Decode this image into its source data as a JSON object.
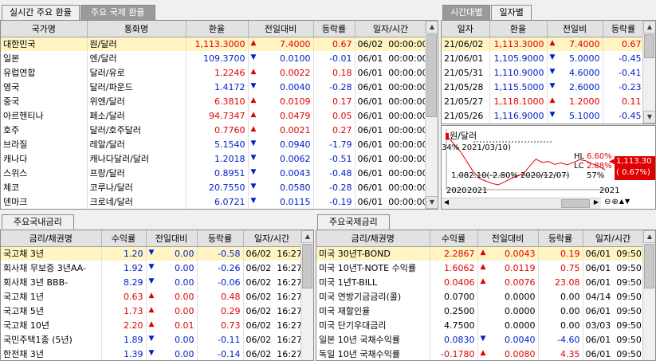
{
  "top_tabs": [
    "실시간 주요 환율",
    "주요 국제 환율"
  ],
  "fx": {
    "headers": [
      "국가명",
      "통화명",
      "환율",
      "전일대비",
      "등락률",
      "일자/시간"
    ],
    "rows": [
      {
        "country": "대한민국",
        "currency": "원/달러",
        "rate": "1,113.3000",
        "dir": "up",
        "change": "7.4000",
        "pct": "0.67",
        "date": "06/02",
        "time": "00:00:00",
        "color": "red"
      },
      {
        "country": "일본",
        "currency": "엔/달러",
        "rate": "109.3700",
        "dir": "dn",
        "change": "0.0100",
        "pct": "-0.01",
        "date": "06/01",
        "time": "00:00:00",
        "color": "blue"
      },
      {
        "country": "유럽연합",
        "currency": "달러/유로",
        "rate": "1.2246",
        "dir": "up",
        "change": "0.0022",
        "pct": "0.18",
        "date": "06/01",
        "time": "00:00:00",
        "color": "red"
      },
      {
        "country": "영국",
        "currency": "달러/파운드",
        "rate": "1.4172",
        "dir": "dn",
        "change": "0.0040",
        "pct": "-0.28",
        "date": "06/01",
        "time": "00:00:00",
        "color": "blue"
      },
      {
        "country": "중국",
        "currency": "위엔/달러",
        "rate": "6.3810",
        "dir": "up",
        "change": "0.0109",
        "pct": "0.17",
        "date": "06/01",
        "time": "00:00:00",
        "color": "red"
      },
      {
        "country": "아르헨티나",
        "currency": "페소/달러",
        "rate": "94.7347",
        "dir": "up",
        "change": "0.0479",
        "pct": "0.05",
        "date": "06/01",
        "time": "00:00:00",
        "color": "red"
      },
      {
        "country": "호주",
        "currency": "달러/호주달러",
        "rate": "0.7760",
        "dir": "up",
        "change": "0.0021",
        "pct": "0.27",
        "date": "06/01",
        "time": "00:00:00",
        "color": "red"
      },
      {
        "country": "브라질",
        "currency": "레알/달러",
        "rate": "5.1540",
        "dir": "dn",
        "change": "0.0940",
        "pct": "-1.79",
        "date": "06/01",
        "time": "00:00:00",
        "color": "blue"
      },
      {
        "country": "캐나다",
        "currency": "캐나다달러/달러",
        "rate": "1.2018",
        "dir": "dn",
        "change": "0.0062",
        "pct": "-0.51",
        "date": "06/01",
        "time": "00:00:00",
        "color": "blue"
      },
      {
        "country": "스위스",
        "currency": "프랑/달러",
        "rate": "0.8951",
        "dir": "dn",
        "change": "0.0043",
        "pct": "-0.48",
        "date": "06/01",
        "time": "00:00:00",
        "color": "blue"
      },
      {
        "country": "체코",
        "currency": "코루나/달러",
        "rate": "20.7550",
        "dir": "dn",
        "change": "0.0580",
        "pct": "-0.28",
        "date": "06/01",
        "time": "00:00:00",
        "color": "blue"
      },
      {
        "country": "덴마크",
        "currency": "크로네/달러",
        "rate": "6.0721",
        "dir": "dn",
        "change": "0.0115",
        "pct": "-0.19",
        "date": "06/01",
        "time": "00:00:00",
        "color": "blue"
      }
    ]
  },
  "side_tabs": [
    "시간대별",
    "일자별"
  ],
  "daily": {
    "headers": [
      "일자",
      "환율",
      "전일비",
      "등락률"
    ],
    "rows": [
      {
        "date": "21/06/02",
        "rate": "1,113.3000",
        "dir": "up",
        "change": "7.4000",
        "pct": "0.67",
        "color": "red"
      },
      {
        "date": "21/06/01",
        "rate": "1,105.9000",
        "dir": "dn",
        "change": "5.0000",
        "pct": "-0.45",
        "color": "blue"
      },
      {
        "date": "21/05/31",
        "rate": "1,110.9000",
        "dir": "dn",
        "change": "4.6000",
        "pct": "-0.41",
        "color": "blue"
      },
      {
        "date": "21/05/28",
        "rate": "1,115.5000",
        "dir": "dn",
        "change": "2.6000",
        "pct": "-0.23",
        "color": "blue"
      },
      {
        "date": "21/05/27",
        "rate": "1,118.1000",
        "dir": "up",
        "change": "1.2000",
        "pct": "0.11",
        "color": "red"
      },
      {
        "date": "21/05/26",
        "rate": "1,116.9000",
        "dir": "dn",
        "change": "5.1000",
        "pct": "-0.45",
        "color": "blue"
      }
    ]
  },
  "mini_chart": {
    "legend": "원/달러",
    "annot_high": "34% 2021/03/10)",
    "annot_low": "1,082.10(-2.80% 2020/12/07)",
    "annot_57": "57%",
    "annot_r1": "6.60%",
    "annot_r2": "2.88%",
    "hl_label": "HL",
    "lc_label": "LC",
    "price_box": "1,113.30",
    "pct_box": "( 0.67%)",
    "x_labels": [
      "2020",
      "2021",
      "2021"
    ],
    "controls": [
      "⊖",
      "⊕",
      "▲",
      "▼"
    ],
    "chart_data": {
      "type": "line",
      "series": [
        {
          "name": "원/달러",
          "values": [
            1180,
            1165,
            1150,
            1130,
            1110,
            1095,
            1090,
            1085,
            1082,
            1088,
            1095,
            1100,
            1105,
            1120,
            1135,
            1128,
            1130,
            1124,
            1127,
            1123,
            1128,
            1134,
            1131,
            1125,
            1120,
            1113
          ]
        }
      ]
    }
  },
  "left_bottom_tab": "주요국내금리",
  "kr": {
    "headers": [
      "금리/채권명",
      "수익률",
      "전일대비",
      "등락률",
      "일자/시간"
    ],
    "rows": [
      {
        "name": "국고채 3년",
        "yield": "1.20",
        "dir": "dn",
        "change": "0.00",
        "pct": "-0.58",
        "date": "06/02",
        "time": "16:27",
        "color": "blue"
      },
      {
        "name": "회사채 무보증 3년AA-",
        "yield": "1.92",
        "dir": "dn",
        "change": "0.00",
        "pct": "-0.26",
        "date": "06/02",
        "time": "16:27",
        "color": "blue"
      },
      {
        "name": "회사채 3년 BBB-",
        "yield": "8.29",
        "dir": "dn",
        "change": "0.00",
        "pct": "-0.06",
        "date": "06/02",
        "time": "16:27",
        "color": "blue"
      },
      {
        "name": "국고채 1년",
        "yield": "0.63",
        "dir": "up",
        "change": "0.00",
        "pct": "0.48",
        "date": "06/02",
        "time": "16:27",
        "color": "red"
      },
      {
        "name": "국고채 5년",
        "yield": "1.73",
        "dir": "up",
        "change": "0.00",
        "pct": "0.29",
        "date": "06/02",
        "time": "16:27",
        "color": "red"
      },
      {
        "name": "국고채 10년",
        "yield": "2.20",
        "dir": "up",
        "change": "0.01",
        "pct": "0.73",
        "date": "06/02",
        "time": "16:27",
        "color": "red"
      },
      {
        "name": "국민주택1종 (5년)",
        "yield": "1.89",
        "dir": "dn",
        "change": "0.00",
        "pct": "-0.11",
        "date": "06/02",
        "time": "16:27",
        "color": "blue"
      },
      {
        "name": "한전채 3년",
        "yield": "1.39",
        "dir": "dn",
        "change": "0.00",
        "pct": "-0.14",
        "date": "06/02",
        "time": "16:27",
        "color": "blue"
      }
    ]
  },
  "right_bottom_tab": "주요국제금리",
  "intl": {
    "headers": [
      "금리/채권명",
      "수익률",
      "전일대비",
      "등락률",
      "일자/시간"
    ],
    "rows": [
      {
        "name": "미국 30년T-BOND",
        "yield": "2.2867",
        "dir": "up",
        "change": "0.0043",
        "pct": "0.19",
        "date": "06/01",
        "time": "09:50",
        "color": "red"
      },
      {
        "name": "미국 10년T-NOTE 수익률",
        "yield": "1.6062",
        "dir": "up",
        "change": "0.0119",
        "pct": "0.75",
        "date": "06/01",
        "time": "09:50",
        "color": "red"
      },
      {
        "name": "미국 1년T-BILL",
        "yield": "0.0406",
        "dir": "up",
        "change": "0.0076",
        "pct": "23.08",
        "date": "06/01",
        "time": "09:50",
        "color": "red"
      },
      {
        "name": "미국 연방기금금리(콜)",
        "yield": "0.0700",
        "dir": "",
        "change": "0.0000",
        "pct": "0.00",
        "date": "04/14",
        "time": "09:50",
        "color": "black"
      },
      {
        "name": "미국 재할인율",
        "yield": "0.2500",
        "dir": "",
        "change": "0.0000",
        "pct": "0.00",
        "date": "06/01",
        "time": "09:50",
        "color": "black"
      },
      {
        "name": "미국 단기우대금리",
        "yield": "4.7500",
        "dir": "",
        "change": "0.0000",
        "pct": "0.00",
        "date": "03/03",
        "time": "09:50",
        "color": "black"
      },
      {
        "name": "일본 10년 국채수익률",
        "yield": "0.0830",
        "dir": "dn",
        "change": "0.0040",
        "pct": "-4.60",
        "date": "06/01",
        "time": "09:50",
        "color": "blue"
      },
      {
        "name": "독일 10년 국채수익률",
        "yield": "-0.1780",
        "dir": "up",
        "change": "0.0080",
        "pct": "4.35",
        "date": "06/01",
        "time": "09:50",
        "color": "red"
      }
    ]
  }
}
